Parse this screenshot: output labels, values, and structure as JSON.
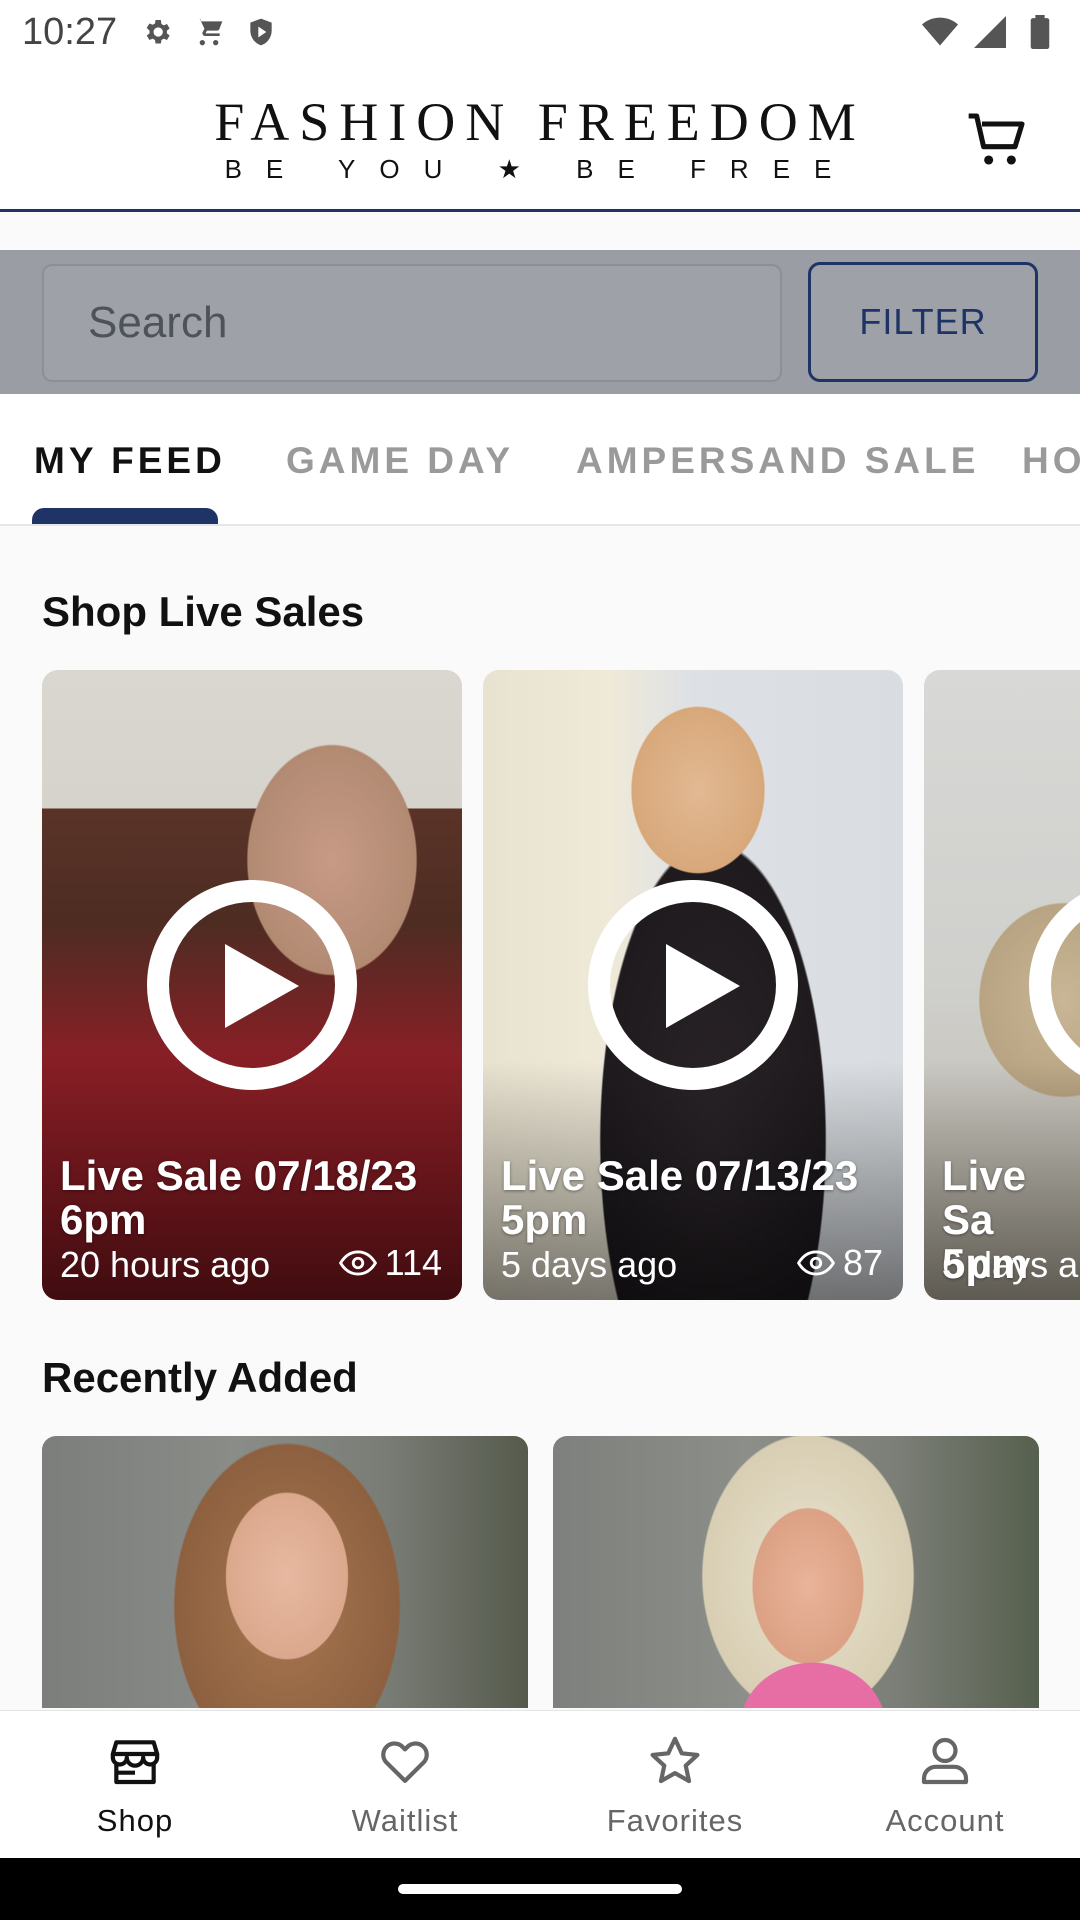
{
  "status_bar": {
    "time": "10:27",
    "left_icons": [
      "gear-icon",
      "shopping-cart-icon",
      "shield-play-icon"
    ],
    "right_icons": [
      "wifi-icon",
      "cell-signal-icon",
      "battery-icon"
    ]
  },
  "header": {
    "logo_title": "FASHION FREEDOM",
    "logo_tagline": "BE YOU ★ BE FREE",
    "cart_icon": "cart-icon"
  },
  "search": {
    "placeholder": "Search",
    "filter_label": "FILTER"
  },
  "tabs": [
    {
      "label": "MY FEED",
      "active": true
    },
    {
      "label": "GAME DAY",
      "active": false
    },
    {
      "label": "AMPERSAND SALE",
      "active": false
    },
    {
      "label": "HO",
      "active": false
    }
  ],
  "live_sales": {
    "title": "Shop Live Sales",
    "cards": [
      {
        "title": "Live Sale 07/18/23 6pm",
        "time_ago": "20 hours ago",
        "views": "114"
      },
      {
        "title": "Live Sale 07/13/23 5pm",
        "time_ago": "5 days ago",
        "views": "87"
      },
      {
        "title": "Live Sa 5pm",
        "time_ago": "6 days a",
        "views": ""
      }
    ]
  },
  "recently_added": {
    "title": "Recently Added"
  },
  "bottom_nav": [
    {
      "label": "Shop",
      "icon": "store-icon",
      "active": true
    },
    {
      "label": "Waitlist",
      "icon": "heart-icon",
      "active": false
    },
    {
      "label": "Favorites",
      "icon": "star-icon",
      "active": false
    },
    {
      "label": "Account",
      "icon": "person-icon",
      "active": false
    }
  ],
  "colors": {
    "brand_navy": "#1f3466",
    "search_strip": "#9a9ea4"
  }
}
